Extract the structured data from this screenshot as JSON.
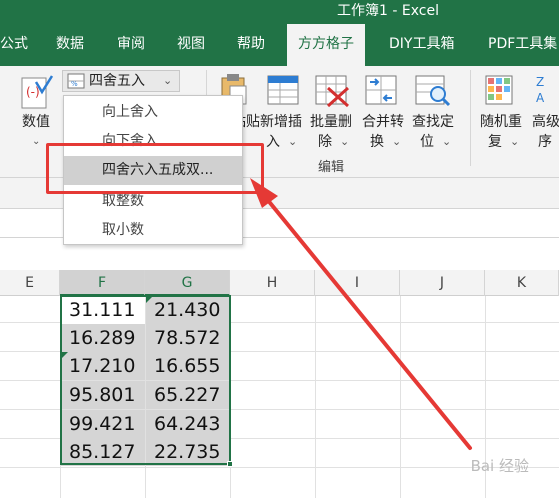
{
  "window": {
    "title": "工作簿1  -  Excel"
  },
  "tabs": [
    {
      "label": "公式"
    },
    {
      "label": "数据"
    },
    {
      "label": "审阅"
    },
    {
      "label": "视图"
    },
    {
      "label": "帮助"
    },
    {
      "label": "方方格子"
    },
    {
      "label": "DIY工具箱"
    },
    {
      "label": "PDF工具集"
    }
  ],
  "ribbon": {
    "numvalue_label": "数值",
    "rounding_dropdown": "四舍五入",
    "paste_label": "粘贴",
    "insert_label_1": "新增插",
    "insert_label_2": "入",
    "delete_label_1": "批量删",
    "delete_label_2": "除",
    "merge_label_1": "合并转",
    "merge_label_2": "换",
    "find_label_1": "查找定",
    "find_label_2": "位",
    "random_label_1": "随机重",
    "random_label_2": "复",
    "advanced_label_1": "高级",
    "advanced_label_2": "序",
    "group_edit": "编辑"
  },
  "menu": {
    "items": [
      {
        "label": "向上舍入"
      },
      {
        "label": "向下舍入"
      },
      {
        "label": "四舍六入五成双..."
      },
      {
        "label": "取整数"
      },
      {
        "label": "取小数"
      }
    ]
  },
  "columns": [
    "E",
    "F",
    "G",
    "H",
    "I",
    "J",
    "K"
  ],
  "table": {
    "rows": [
      [
        "31.111",
        "21.430"
      ],
      [
        "16.289",
        "78.572"
      ],
      [
        "17.210",
        "16.655"
      ],
      [
        "95.801",
        "65.227"
      ],
      [
        "99.421",
        "64.243"
      ],
      [
        "85.127",
        "22.735"
      ]
    ]
  },
  "watermark": "Bai 经验",
  "colors": {
    "accent": "#217346",
    "highlight_box": "#e53935",
    "arrow": "#e53935"
  }
}
